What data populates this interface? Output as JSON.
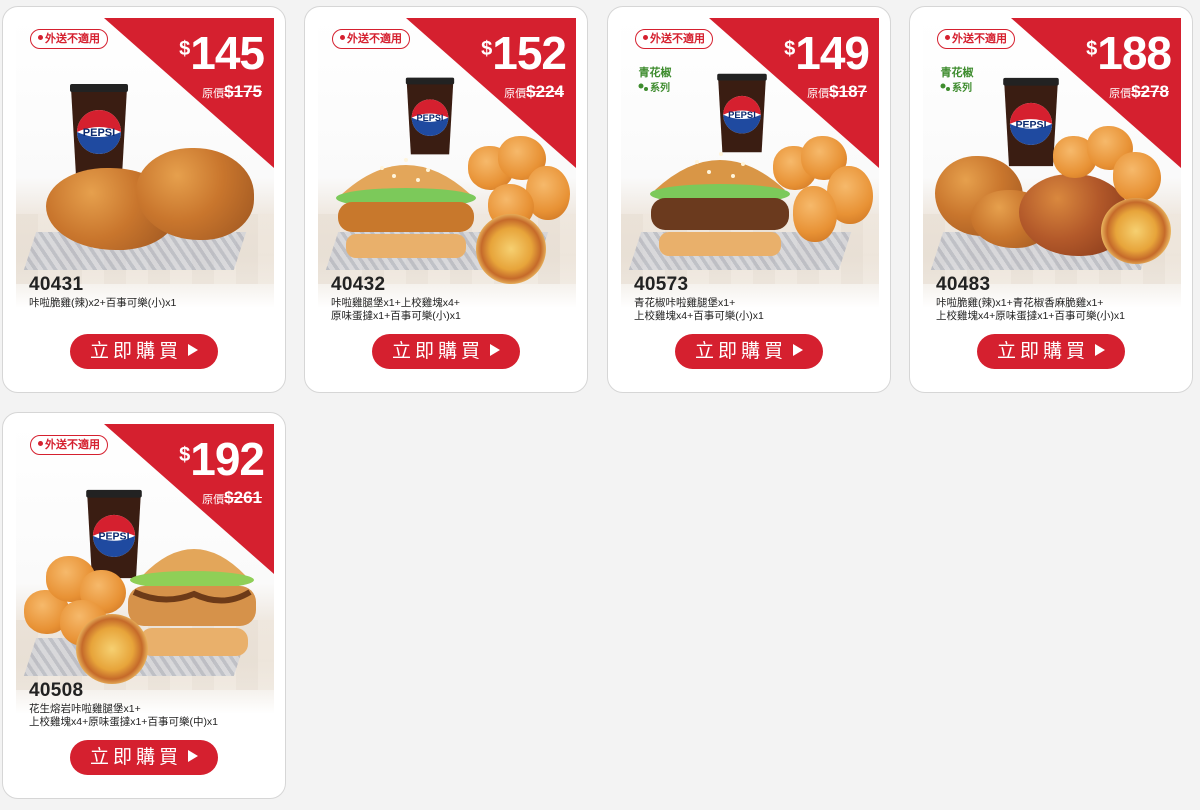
{
  "colors": {
    "brand_red": "#d5202f",
    "background": "#f3f3f3"
  },
  "cards": [
    {
      "tag": "外送不適用",
      "currency": "$",
      "price": "145",
      "orig_label": "原價",
      "orig_price": "$175",
      "code": "40431",
      "desc_line1": "咔啦脆雞(辣)x2+百事可樂(小)x1",
      "desc_line2": "",
      "button": "立即購買",
      "pepper_series": false,
      "cup_brand": "PEPSI"
    },
    {
      "tag": "外送不適用",
      "currency": "$",
      "price": "152",
      "orig_label": "原價",
      "orig_price": "$224",
      "code": "40432",
      "desc_line1": "咔啦雞腿堡x1+上校雞塊x4+",
      "desc_line2": "原味蛋撻x1+百事可樂(小)x1",
      "button": "立即購買",
      "pepper_series": false,
      "cup_brand": "PEPSI"
    },
    {
      "tag": "外送不適用",
      "currency": "$",
      "price": "149",
      "orig_label": "原價",
      "orig_price": "$187",
      "code": "40573",
      "desc_line1": "青花椒咔啦雞腿堡x1+",
      "desc_line2": "上校雞塊x4+百事可樂(小)x1",
      "button": "立即購買",
      "pepper_series": true,
      "pepper_text1": "青花椒",
      "pepper_text2": "系列",
      "cup_brand": "PEPSI"
    },
    {
      "tag": "外送不適用",
      "currency": "$",
      "price": "188",
      "orig_label": "原價",
      "orig_price": "$278",
      "code": "40483",
      "desc_line1": "咔啦脆雞(辣)x1+青花椒香麻脆雞x1+",
      "desc_line2": "上校雞塊x4+原味蛋撻x1+百事可樂(小)x1",
      "button": "立即購買",
      "pepper_series": true,
      "pepper_text1": "青花椒",
      "pepper_text2": "系列",
      "cup_brand": "PEPSI"
    },
    {
      "tag": "外送不適用",
      "currency": "$",
      "price": "192",
      "orig_label": "原價",
      "orig_price": "$261",
      "code": "40508",
      "desc_line1": "花生熔岩咔啦雞腿堡x1+",
      "desc_line2": "上校雞塊x4+原味蛋撻x1+百事可樂(中)x1",
      "button": "立即購買",
      "pepper_series": false,
      "cup_brand": "PEPSI"
    }
  ]
}
